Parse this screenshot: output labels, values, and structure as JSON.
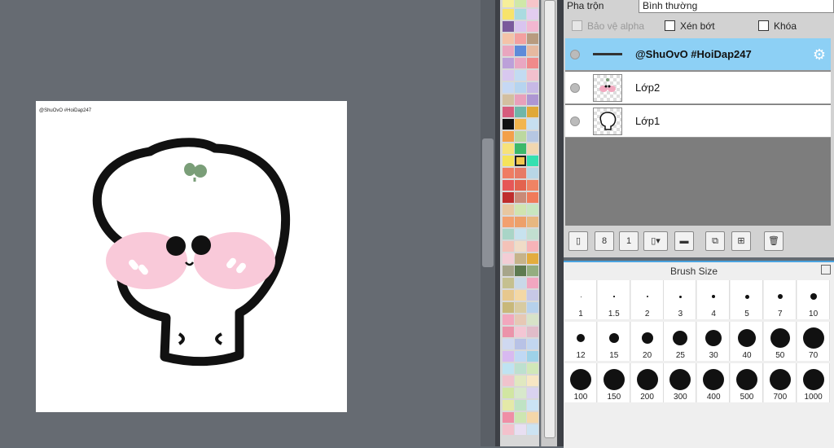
{
  "canvas": {
    "watermark": "@ShuOvO #HoiDap247"
  },
  "colors": {
    "layer_active": "#8dd0f5",
    "accent_line": "#4aa3df",
    "cheek": "#f9c9d9",
    "sprout": "#7a9e78"
  },
  "layer_panel": {
    "blend_label": "Pha trộn",
    "blend_value": "Bình thường",
    "options": [
      {
        "label": "Bảo vệ alpha",
        "disabled": true
      },
      {
        "label": "Xén bớt",
        "disabled": false
      },
      {
        "label": "Khóa",
        "disabled": false
      }
    ],
    "layers": [
      {
        "name": "@ShuOvO #HoiDap247",
        "active": true,
        "icon": "gear-icon"
      },
      {
        "name": "Lớp2",
        "active": false
      },
      {
        "name": "Lớp1",
        "active": false
      }
    ],
    "toolbar_icons": [
      "new-layer-icon",
      "new-layer-8bit-icon",
      "new-layer-1bit-icon",
      "add-layer-menu-icon",
      "new-folder-icon",
      "duplicate-layer-icon",
      "merge-layer-icon",
      "delete-layer-icon"
    ]
  },
  "brush_panel": {
    "title": "Brush Size",
    "sizes": [
      "1",
      "1.5",
      "2",
      "3",
      "4",
      "5",
      "7",
      "10",
      "12",
      "15",
      "20",
      "25",
      "30",
      "40",
      "50",
      "70",
      "100",
      "150",
      "200",
      "300",
      "400",
      "500",
      "700",
      "1000"
    ]
  },
  "palette": {
    "colors": [
      [
        "#f6ef9a",
        "#cfe8a8",
        "#f6c5c9"
      ],
      [
        "#f7e36b",
        "#a9dbe0",
        "#e3cdf0"
      ],
      [
        "#7a5a9c",
        "#d9c4ef",
        "#f2b7d1"
      ],
      [
        "#f4c3a8",
        "#f3a0a0",
        "#b89b7f"
      ],
      [
        "#e9a6bf",
        "#5e8bd9",
        "#e6b9a0"
      ],
      [
        "#bca0d9",
        "#e9a7c2",
        "#f08a8a"
      ],
      [
        "#d8c8ef",
        "#c2dbf2",
        "#f2c0cd"
      ],
      [
        "#c6d8f4",
        "#b6d4ef",
        "#c7b9e6"
      ],
      [
        "#d3bfa0",
        "#e8a0bb",
        "#ad96d2"
      ],
      [
        "#d65c7d",
        "#6fb6a9",
        "#e0a838"
      ],
      [
        "#111111",
        "#f2b54e",
        "#c6dff0"
      ],
      [
        "#f3a04a",
        "#bcd8a0",
        "#b6c7e2"
      ],
      [
        "#f7e27a",
        "#3cb86a",
        "#f1d7b0"
      ],
      [
        "#f5e35a",
        "#f2c64e",
        "#34e0b0"
      ],
      [
        "#ef7c62",
        "#e77a66",
        "#b8d6e6"
      ],
      [
        "#e65757",
        "#e3634f",
        "#ef8364"
      ],
      [
        "#bf2d2d",
        "#c98a78",
        "#f07a5a"
      ],
      [
        "#e8c7a0",
        "#d0e4b0",
        "#c8e6c0"
      ],
      [
        "#f2a06f",
        "#eda06a",
        "#e7b780"
      ],
      [
        "#a9d5c7",
        "#c7e2ee",
        "#c2dfd0"
      ],
      [
        "#f4c2b8",
        "#f0dcc7",
        "#f7b3b8"
      ],
      [
        "#f3cdd5",
        "#c6b38a",
        "#e3ac3e"
      ],
      [
        "#a7a58a",
        "#5e7a50",
        "#94ad80"
      ],
      [
        "#c5c08f",
        "#c9d9e8",
        "#f1a6c0"
      ],
      [
        "#e7c88e",
        "#f4d8a5",
        "#c7c8e6"
      ],
      [
        "#c8b87a",
        "#d8cba1",
        "#b6d1ec"
      ],
      [
        "#f2a7bd",
        "#e6c8b5",
        "#d7e3c8"
      ],
      [
        "#eb93aa",
        "#f3c6d4",
        "#e0bcc9"
      ],
      [
        "#cfd8f0",
        "#b8c2e6",
        "#c2d6f0"
      ],
      [
        "#d8b9f0",
        "#c0d8f4",
        "#9ed2e8"
      ],
      [
        "#bfe3f2",
        "#bde0cf",
        "#d1e8b8"
      ],
      [
        "#f0c3cd",
        "#e0e8c0",
        "#f7e6c4"
      ],
      [
        "#d1e6a2",
        "#d7e8cb",
        "#d9d2f0"
      ],
      [
        "#e4e9a8",
        "#bfe3c4",
        "#cbe3f4"
      ],
      [
        "#ef8ea6",
        "#cde6b2",
        "#f4d7a9"
      ],
      [
        "#f3c1cc",
        "#e8dff2",
        "#cce3f2"
      ]
    ]
  }
}
